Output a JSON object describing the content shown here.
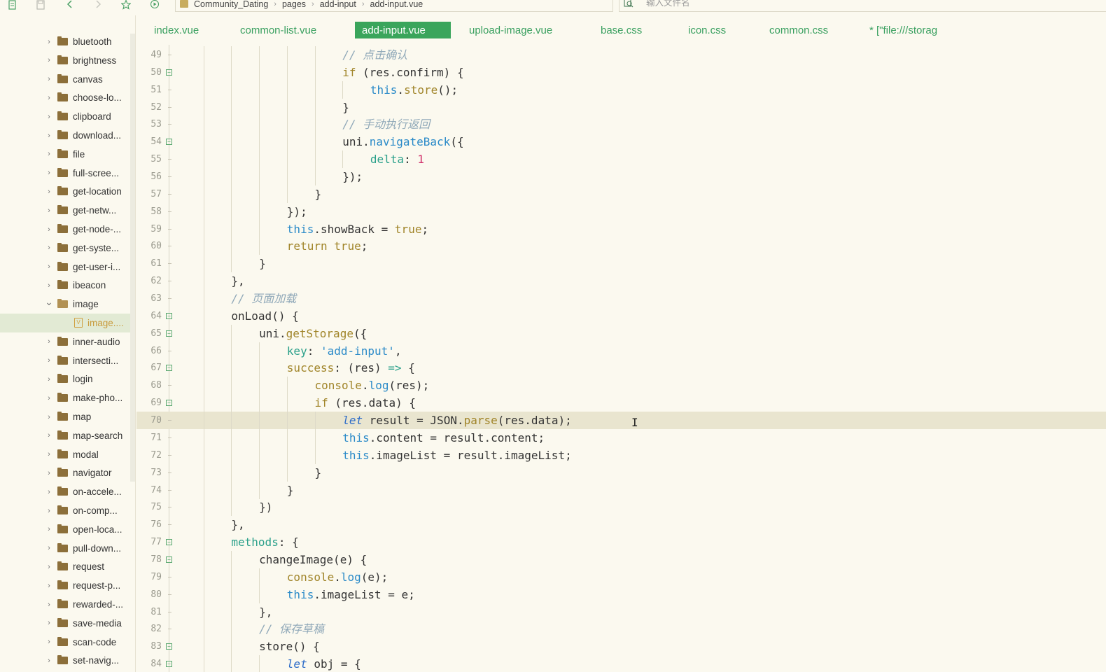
{
  "toolbar": {
    "icons": [
      "new-file-icon",
      "save-icon",
      "back-arrow-icon",
      "forward-arrow-icon",
      "star-icon",
      "run-icon"
    ]
  },
  "breadcrumb": {
    "items": [
      "Community_Dating",
      "pages",
      "add-input",
      "add-input.vue"
    ]
  },
  "search": {
    "placeholder": "输入文件名"
  },
  "tabs": [
    {
      "label": "index.vue",
      "active": false
    },
    {
      "label": "common-list.vue",
      "active": false
    },
    {
      "label": "add-input.vue",
      "active": true
    },
    {
      "label": "upload-image.vue",
      "active": false
    },
    {
      "label": "base.css",
      "active": false
    },
    {
      "label": "icon.css",
      "active": false
    },
    {
      "label": "common.css",
      "active": false
    },
    {
      "label": "* [\"file:///storag",
      "active": false
    }
  ],
  "sidebar": {
    "items": [
      {
        "label": "bluetooth",
        "type": "folder",
        "expanded": false
      },
      {
        "label": "brightness",
        "type": "folder",
        "expanded": false
      },
      {
        "label": "canvas",
        "type": "folder",
        "expanded": false
      },
      {
        "label": "choose-lo...",
        "type": "folder",
        "expanded": false
      },
      {
        "label": "clipboard",
        "type": "folder",
        "expanded": false
      },
      {
        "label": "download...",
        "type": "folder",
        "expanded": false
      },
      {
        "label": "file",
        "type": "folder",
        "expanded": false
      },
      {
        "label": "full-scree...",
        "type": "folder",
        "expanded": false
      },
      {
        "label": "get-location",
        "type": "folder",
        "expanded": false
      },
      {
        "label": "get-netw...",
        "type": "folder",
        "expanded": false
      },
      {
        "label": "get-node-...",
        "type": "folder",
        "expanded": false
      },
      {
        "label": "get-syste...",
        "type": "folder",
        "expanded": false
      },
      {
        "label": "get-user-i...",
        "type": "folder",
        "expanded": false
      },
      {
        "label": "ibeacon",
        "type": "folder",
        "expanded": false
      },
      {
        "label": "image",
        "type": "folder",
        "expanded": true
      },
      {
        "label": "image....",
        "type": "file",
        "selected": true
      },
      {
        "label": "inner-audio",
        "type": "folder",
        "expanded": false
      },
      {
        "label": "intersecti...",
        "type": "folder",
        "expanded": false
      },
      {
        "label": "login",
        "type": "folder",
        "expanded": false
      },
      {
        "label": "make-pho...",
        "type": "folder",
        "expanded": false
      },
      {
        "label": "map",
        "type": "folder",
        "expanded": false
      },
      {
        "label": "map-search",
        "type": "folder",
        "expanded": false
      },
      {
        "label": "modal",
        "type": "folder",
        "expanded": false
      },
      {
        "label": "navigator",
        "type": "folder",
        "expanded": false
      },
      {
        "label": "on-accele...",
        "type": "folder",
        "expanded": false
      },
      {
        "label": "on-comp...",
        "type": "folder",
        "expanded": false
      },
      {
        "label": "open-loca...",
        "type": "folder",
        "expanded": false
      },
      {
        "label": "pull-down...",
        "type": "folder",
        "expanded": false
      },
      {
        "label": "request",
        "type": "folder",
        "expanded": false
      },
      {
        "label": "request-p...",
        "type": "folder",
        "expanded": false
      },
      {
        "label": "rewarded-...",
        "type": "folder",
        "expanded": false
      },
      {
        "label": "save-media",
        "type": "folder",
        "expanded": false
      },
      {
        "label": "scan-code",
        "type": "folder",
        "expanded": false
      },
      {
        "label": "set-navig...",
        "type": "folder",
        "expanded": false
      }
    ]
  },
  "editor": {
    "current_line": 70,
    "lines": [
      {
        "n": 49,
        "indent": 6,
        "fold": false,
        "tokens": [
          [
            "cmt",
            "// 点击确认"
          ]
        ]
      },
      {
        "n": 50,
        "indent": 6,
        "fold": true,
        "tokens": [
          [
            "kw",
            "if"
          ],
          [
            "plain",
            " (res.confirm) {"
          ]
        ]
      },
      {
        "n": 51,
        "indent": 7,
        "fold": false,
        "tokens": [
          [
            "this",
            "this"
          ],
          [
            "plain",
            "."
          ],
          [
            "fn",
            "store"
          ],
          [
            "plain",
            "();"
          ]
        ]
      },
      {
        "n": 52,
        "indent": 6,
        "fold": false,
        "tokens": [
          [
            "plain",
            "}"
          ]
        ]
      },
      {
        "n": 53,
        "indent": 6,
        "fold": false,
        "tokens": [
          [
            "cmt",
            "// 手动执行返回"
          ]
        ]
      },
      {
        "n": 54,
        "indent": 6,
        "fold": true,
        "tokens": [
          [
            "plain",
            "uni."
          ],
          [
            "prop",
            "navigateBack"
          ],
          [
            "plain",
            "({"
          ]
        ]
      },
      {
        "n": 55,
        "indent": 7,
        "fold": false,
        "tokens": [
          [
            "key",
            "delta"
          ],
          [
            "plain",
            ": "
          ],
          [
            "num",
            "1"
          ]
        ]
      },
      {
        "n": 56,
        "indent": 6,
        "fold": false,
        "tokens": [
          [
            "plain",
            "});"
          ]
        ]
      },
      {
        "n": 57,
        "indent": 5,
        "fold": false,
        "tokens": [
          [
            "plain",
            "}"
          ]
        ]
      },
      {
        "n": 58,
        "indent": 4,
        "fold": false,
        "tokens": [
          [
            "plain",
            "});"
          ]
        ]
      },
      {
        "n": 59,
        "indent": 4,
        "fold": false,
        "tokens": [
          [
            "this",
            "this"
          ],
          [
            "plain",
            ".showBack = "
          ],
          [
            "kw",
            "true"
          ],
          [
            "plain",
            ";"
          ]
        ]
      },
      {
        "n": 60,
        "indent": 4,
        "fold": false,
        "tokens": [
          [
            "kw",
            "return"
          ],
          [
            "plain",
            " "
          ],
          [
            "kw",
            "true"
          ],
          [
            "plain",
            ";"
          ]
        ]
      },
      {
        "n": 61,
        "indent": 3,
        "fold": false,
        "tokens": [
          [
            "plain",
            "}"
          ]
        ]
      },
      {
        "n": 62,
        "indent": 2,
        "fold": false,
        "tokens": [
          [
            "plain",
            "},"
          ]
        ]
      },
      {
        "n": 63,
        "indent": 2,
        "fold": false,
        "tokens": [
          [
            "cmt",
            "// 页面加载"
          ]
        ]
      },
      {
        "n": 64,
        "indent": 2,
        "fold": true,
        "tokens": [
          [
            "plain",
            "onLoad() {"
          ]
        ]
      },
      {
        "n": 65,
        "indent": 3,
        "fold": true,
        "tokens": [
          [
            "plain",
            "uni."
          ],
          [
            "fn",
            "getStorage"
          ],
          [
            "plain",
            "({"
          ]
        ]
      },
      {
        "n": 66,
        "indent": 4,
        "fold": false,
        "tokens": [
          [
            "key",
            "key"
          ],
          [
            "plain",
            ": "
          ],
          [
            "str",
            "'add-input'"
          ],
          [
            "plain",
            ","
          ]
        ]
      },
      {
        "n": 67,
        "indent": 4,
        "fold": true,
        "tokens": [
          [
            "obj",
            "success"
          ],
          [
            "plain",
            ": (res) "
          ],
          [
            "key",
            "=>"
          ],
          [
            "plain",
            " {"
          ]
        ]
      },
      {
        "n": 68,
        "indent": 5,
        "fold": false,
        "tokens": [
          [
            "obj",
            "console"
          ],
          [
            "plain",
            "."
          ],
          [
            "prop",
            "log"
          ],
          [
            "plain",
            "(res);"
          ]
        ]
      },
      {
        "n": 69,
        "indent": 5,
        "fold": true,
        "tokens": [
          [
            "kw",
            "if"
          ],
          [
            "plain",
            " (res.data) {"
          ]
        ]
      },
      {
        "n": 70,
        "indent": 6,
        "fold": false,
        "tokens": [
          [
            "let",
            "let"
          ],
          [
            "plain",
            " result = JSON."
          ],
          [
            "fn",
            "parse"
          ],
          [
            "plain",
            "(res.data);"
          ]
        ]
      },
      {
        "n": 71,
        "indent": 6,
        "fold": false,
        "tokens": [
          [
            "this",
            "this"
          ],
          [
            "plain",
            ".content = result.content;"
          ]
        ]
      },
      {
        "n": 72,
        "indent": 6,
        "fold": false,
        "tokens": [
          [
            "this",
            "this"
          ],
          [
            "plain",
            ".imageList = result.imageList;"
          ]
        ]
      },
      {
        "n": 73,
        "indent": 5,
        "fold": false,
        "tokens": [
          [
            "plain",
            "}"
          ]
        ]
      },
      {
        "n": 74,
        "indent": 4,
        "fold": false,
        "tokens": [
          [
            "plain",
            "}"
          ]
        ]
      },
      {
        "n": 75,
        "indent": 3,
        "fold": false,
        "tokens": [
          [
            "plain",
            "})"
          ]
        ]
      },
      {
        "n": 76,
        "indent": 2,
        "fold": false,
        "tokens": [
          [
            "plain",
            "},"
          ]
        ]
      },
      {
        "n": 77,
        "indent": 2,
        "fold": true,
        "tokens": [
          [
            "key",
            "methods"
          ],
          [
            "plain",
            ": {"
          ]
        ]
      },
      {
        "n": 78,
        "indent": 3,
        "fold": true,
        "tokens": [
          [
            "plain",
            "changeImage(e) {"
          ]
        ]
      },
      {
        "n": 79,
        "indent": 4,
        "fold": false,
        "tokens": [
          [
            "obj",
            "console"
          ],
          [
            "plain",
            "."
          ],
          [
            "prop",
            "log"
          ],
          [
            "plain",
            "(e);"
          ]
        ]
      },
      {
        "n": 80,
        "indent": 4,
        "fold": false,
        "tokens": [
          [
            "this",
            "this"
          ],
          [
            "plain",
            ".imageList = e;"
          ]
        ]
      },
      {
        "n": 81,
        "indent": 3,
        "fold": false,
        "tokens": [
          [
            "plain",
            "},"
          ]
        ]
      },
      {
        "n": 82,
        "indent": 3,
        "fold": false,
        "tokens": [
          [
            "cmt",
            "// 保存草稿"
          ]
        ]
      },
      {
        "n": 83,
        "indent": 3,
        "fold": true,
        "tokens": [
          [
            "plain",
            "store() {"
          ]
        ]
      },
      {
        "n": 84,
        "indent": 4,
        "fold": true,
        "tokens": [
          [
            "let",
            "let"
          ],
          [
            "plain",
            " obj = {"
          ]
        ]
      }
    ]
  },
  "colors": {
    "background": "#fbf9ef",
    "accent": "#3aa55b",
    "current_line": "#e9e5cf",
    "selected_row": "#e2ead4"
  }
}
